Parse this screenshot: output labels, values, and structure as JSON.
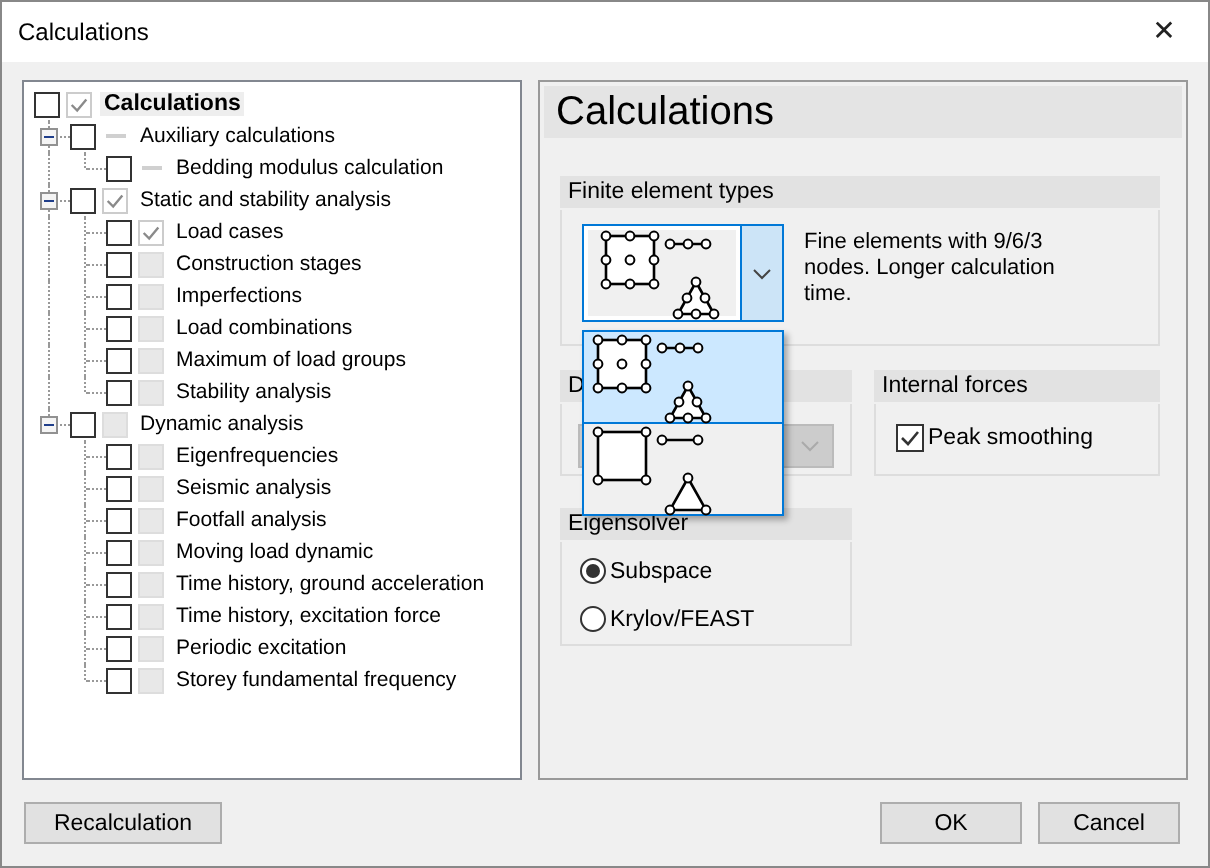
{
  "window": {
    "title": "Calculations",
    "close": "✕"
  },
  "tree": [
    {
      "label": "Calculations",
      "checked": false,
      "kind": "check",
      "selected": true,
      "children": [
        {
          "label": "Auxiliary calculations",
          "checked": false,
          "kind": "dash",
          "selected": false,
          "expanded": true,
          "children": [
            {
              "label": "Bedding modulus calculation",
              "checked": false,
              "kind": "dash",
              "selected": false
            }
          ]
        },
        {
          "label": "Static and stability analysis",
          "checked": false,
          "kind": "check",
          "selected": false,
          "expanded": true,
          "children": [
            {
              "label": "Load cases",
              "checked": false,
              "kind": "check",
              "selected": false
            },
            {
              "label": "Construction stages",
              "checked": false,
              "kind": "box",
              "selected": false
            },
            {
              "label": "Imperfections",
              "checked": false,
              "kind": "box",
              "selected": false
            },
            {
              "label": "Load combinations",
              "checked": false,
              "kind": "box",
              "selected": false
            },
            {
              "label": "Maximum of load groups",
              "checked": false,
              "kind": "box",
              "selected": false
            },
            {
              "label": "Stability analysis",
              "checked": false,
              "kind": "box",
              "selected": false
            }
          ]
        },
        {
          "label": "Dynamic analysis",
          "checked": false,
          "kind": "box",
          "selected": false,
          "expanded": true,
          "children": [
            {
              "label": "Eigenfrequencies",
              "checked": false,
              "kind": "box",
              "selected": false
            },
            {
              "label": "Seismic analysis",
              "checked": false,
              "kind": "box",
              "selected": false
            },
            {
              "label": "Footfall analysis",
              "checked": false,
              "kind": "box",
              "selected": false
            },
            {
              "label": "Moving load dynamic",
              "checked": false,
              "kind": "box",
              "selected": false
            },
            {
              "label": "Time history, ground acceleration",
              "checked": false,
              "kind": "box",
              "selected": false
            },
            {
              "label": "Time history, excitation force",
              "checked": false,
              "kind": "box",
              "selected": false
            },
            {
              "label": "Periodic excitation",
              "checked": false,
              "kind": "box",
              "selected": false
            },
            {
              "label": "Storey fundamental frequency",
              "checked": false,
              "kind": "box",
              "selected": false
            }
          ]
        }
      ]
    }
  ],
  "panel": {
    "title": "Calculations",
    "finite_element_types": {
      "title": "Finite element types",
      "value": {
        "kind": "fine"
      },
      "description": "Fine elements with 9/6/3 nodes. Longer calculation time.",
      "options": [
        {
          "kind": "fine",
          "selected": true
        },
        {
          "kind": "coarse",
          "selected": false
        }
      ]
    },
    "group_2": {
      "title": "D",
      "disabled": true
    },
    "internal_forces": {
      "title": "Internal forces",
      "options": [
        {
          "label": "Peak smoothing",
          "checked": true
        }
      ]
    },
    "eigensolver": {
      "title": "Eigensolver",
      "options": [
        {
          "label": "Subspace",
          "selected": true
        },
        {
          "label": "Krylov/FEAST",
          "selected": false
        }
      ]
    }
  },
  "buttons": {
    "left": "Recalculation",
    "ok": "OK",
    "cancel": "Cancel"
  }
}
